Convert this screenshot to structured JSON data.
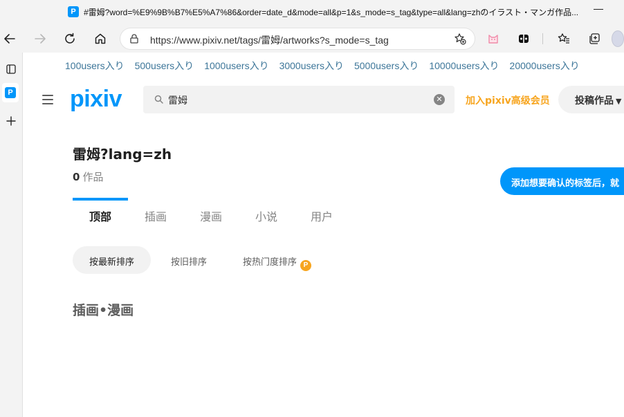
{
  "window": {
    "title": "#雷姆?word=%E9%9B%B7%E5%A7%86&order=date_d&mode=all&p=1&s_mode=s_tag&type=all&lang=zhのイラスト・マンガ作品...",
    "favicon_letter": "P"
  },
  "toolbar": {
    "url": "https://www.pixiv.net/tags/雷姆/artworks?s_mode=s_tag",
    "icons": [
      "back-icon",
      "forward-icon",
      "refresh-icon",
      "home-icon",
      "site-info-icon",
      "add-favorite-icon",
      "cat-extension-icon",
      "extension-icon",
      "favorites-icon",
      "collections-icon"
    ]
  },
  "rail": {
    "items": [
      "tab-actions-icon",
      "pixiv-tab",
      "new-tab-icon"
    ],
    "active_letter": "P"
  },
  "users_links": [
    "100users入り",
    "500users入り",
    "1000users入り",
    "3000users入り",
    "5000users入り",
    "10000users入り",
    "20000users入り"
  ],
  "header": {
    "logo": "pixiv",
    "search_value": "雷姆",
    "premium_link": "加入pixiv高级会员",
    "post_button": "投稿作品"
  },
  "tag": {
    "title": "雷姆?lang=zh",
    "count_value": "0",
    "count_label": "作品",
    "banner": "添加想要确认的标签后，就"
  },
  "tabs": [
    "顶部",
    "插画",
    "漫画",
    "小说",
    "用户"
  ],
  "sort": {
    "newest": "按最新排序",
    "oldest": "按旧排序",
    "popular": "按热门度排序",
    "premium_badge": "P"
  },
  "section_title": "插画•漫画",
  "colors": {
    "brand": "#0096fa",
    "premium": "#f7a51f",
    "tag_link": "#3d7699"
  }
}
